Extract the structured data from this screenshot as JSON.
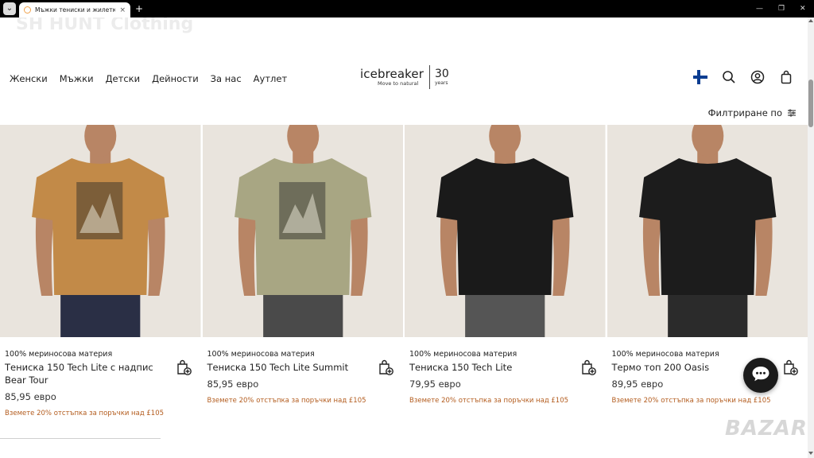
{
  "browser": {
    "tab_title": "Мъжки тениски и жилетки | I",
    "tab_close": "×",
    "menu_glyph": "⌄",
    "new_tab": "+",
    "minimize": "—",
    "maximize": "❐",
    "close": "✕"
  },
  "watermark": "SH HUNT Clothing",
  "nav": [
    "Женски",
    "Мъжки",
    "Детски",
    "Дейности",
    "За нас",
    "Аутлет"
  ],
  "logo": {
    "brand": "icebreaker",
    "tagline": "Move to natural",
    "anniversary": "30",
    "anniversary_unit": "years"
  },
  "header_icons": [
    "finland-flag-icon",
    "search-icon",
    "account-icon",
    "shopping-bag-icon"
  ],
  "colors": {
    "promo": "#b35c1e",
    "flag_blue": "#0b3d91",
    "chat_bg": "#1b1b1b"
  },
  "filter": {
    "label": "Филтриране по"
  },
  "products": [
    {
      "material": "100% мериносова материя",
      "name": "Тениска 150 Tech Lite с надпис Bear Tour",
      "price": "85,95 евро",
      "promo": "Вземете 20% отстъпка за поръчки над £105",
      "shirt_color": "#c28a48",
      "pants_color": "#2a2f45",
      "has_graphic": true
    },
    {
      "material": "100% мериносова материя",
      "name": "Тениска 150 Tech Lite Summit",
      "price": "85,95 евро",
      "promo": "Вземете 20% отстъпка за поръчки над £105",
      "shirt_color": "#a8a683",
      "pants_color": "#4a4a4a",
      "has_graphic": true
    },
    {
      "material": "100% мериносова материя",
      "name": "Тениска 150 Tech Lite",
      "price": "79,95 евро",
      "promo": "Вземете 20% отстъпка за поръчки над £105",
      "shirt_color": "#1a1a1a",
      "pants_color": "#555555",
      "has_graphic": false
    },
    {
      "material": "100% мериносова материя",
      "name": "Термо топ 200 Oasis",
      "price": "89,95 евро",
      "promo": "Вземете 20% отстъпка за поръчки над £105",
      "shirt_color": "#1c1c1c",
      "pants_color": "#2b2b2b",
      "has_graphic": false
    }
  ],
  "chat": {
    "icon": "chat-icon"
  },
  "bazar_watermark": "BAZAR"
}
